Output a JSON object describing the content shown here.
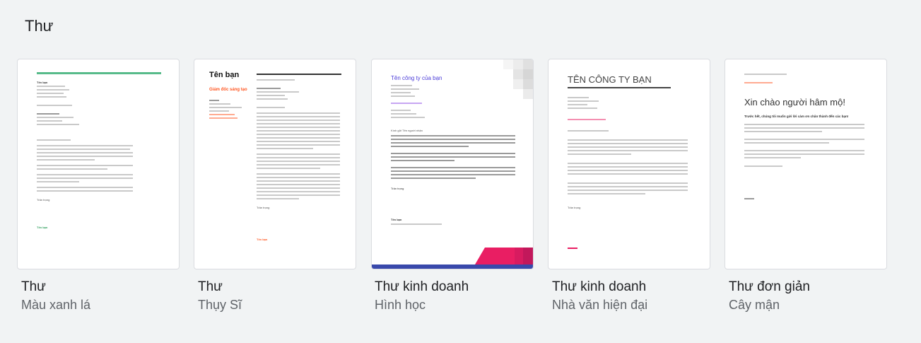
{
  "section": {
    "title": "Thư"
  },
  "templates": [
    {
      "name": "Thư",
      "subtitle": "Màu xanh lá",
      "preview": {
        "sender": "Tên bạn",
        "closing": "Trân trọng",
        "signature": "Tên bạn",
        "accent": "#57bb8a"
      }
    },
    {
      "name": "Thư",
      "subtitle": "Thụy Sĩ",
      "preview": {
        "name": "Tên bạn",
        "role": "Giám đốc sáng tạo",
        "closing": "Trân trọng",
        "signature": "Tên bạn",
        "accent": "#ff5722"
      }
    },
    {
      "name": "Thư kinh doanh",
      "subtitle": "Hình học",
      "preview": {
        "company": "Tên công ty của bạn",
        "greeting": "Kính gửi Tên người nhận",
        "closing": "Trân trọng",
        "signature": "Tên bạn",
        "accent": "#4a3bd8"
      }
    },
    {
      "name": "Thư kinh doanh",
      "subtitle": "Nhà văn hiện đại",
      "preview": {
        "company": "TÊN CÔNG TY BẠN",
        "closing": "Trân trọng",
        "accent": "#e91e63"
      }
    },
    {
      "name": "Thư đơn giản",
      "subtitle": "Cây mận",
      "preview": {
        "heading": "Xin chào người hâm mộ!",
        "subheading": "Trước hết, chúng tôi muốn gửi lời cảm ơn chân thành đến các bạn!",
        "accent": "#ff5722"
      }
    }
  ]
}
